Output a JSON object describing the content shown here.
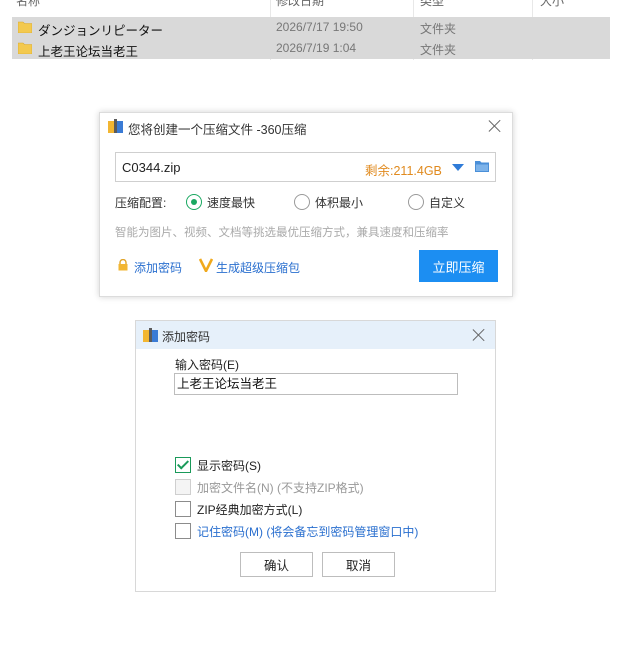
{
  "explorer": {
    "columns": [
      "名称",
      "修改日期",
      "类型",
      "大小"
    ],
    "rows": [
      {
        "name": "ダンジョンリピーター",
        "date": "2026/7/17 19:50",
        "type": "文件夹"
      },
      {
        "name": "上老王论坛当老王",
        "date": "2026/7/19 1:04",
        "type": "文件夹"
      }
    ]
  },
  "compress_dialog": {
    "title": "您将创建一个压缩文件 -360压缩",
    "filename": "C0344.zip",
    "free_space": "剩余:211.4GB",
    "config_label": "压缩配置:",
    "options": [
      "速度最快",
      "体积最小",
      "自定义"
    ],
    "selected_option": "速度最快",
    "hint": "智能为图片、视频、文档等挑选最优压缩方式，兼具速度和压缩率",
    "add_password": "添加密码",
    "super_compress": "生成超级压缩包",
    "compress_now": "立即压缩",
    "accent_color": "#1c8ef2"
  },
  "password_dialog": {
    "title": "添加密码",
    "input_label": "输入密码(E)",
    "password_value": "上老王论坛当老王",
    "checkboxes": [
      {
        "label": "显示密码(S)",
        "checked": true,
        "enabled": true
      },
      {
        "label": "加密文件名(N) (不支持ZIP格式)",
        "checked": false,
        "enabled": false
      },
      {
        "label": "ZIP经典加密方式(L)",
        "checked": false,
        "enabled": true
      },
      {
        "label": "记住密码(M) (将会备忘到密码管理窗口中)",
        "checked": false,
        "enabled": true
      }
    ],
    "ok": "确认",
    "cancel": "取消"
  }
}
